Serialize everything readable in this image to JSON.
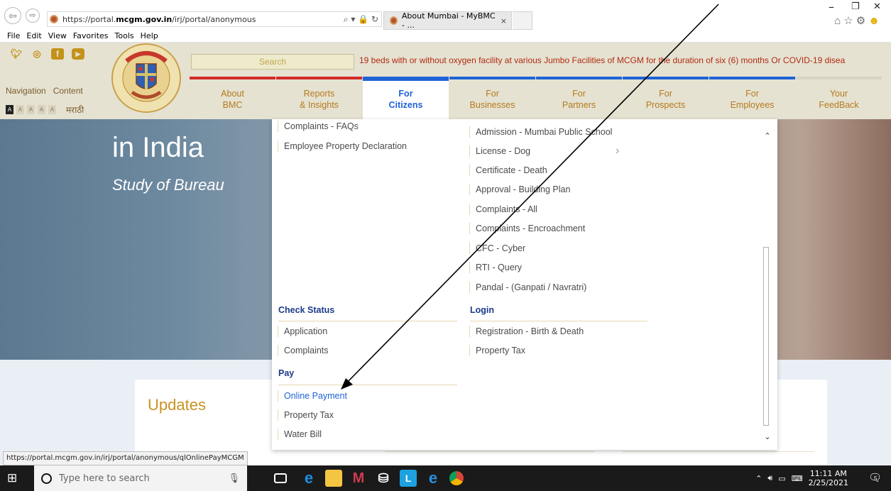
{
  "browser": {
    "back_icon": "back-arrow-icon",
    "forward_icon": "forward-arrow-icon",
    "url_prefix": "https://portal.",
    "url_domain": "mcgm.gov.in",
    "url_path": "/irj/portal/anonymous",
    "address_actions": "⌕ ▾ 🔒 ↻",
    "tab_title": "About Mumbai - MyBMC - ...",
    "tab_close": "×",
    "window_min": "–",
    "window_restore": "❐",
    "window_close": "✕",
    "menu": [
      "File",
      "Edit",
      "View",
      "Favorites",
      "Tools",
      "Help"
    ],
    "status_url": "https://portal.mcgm.gov.in/irj/portal/anonymous/qlOnlinePayMCGM"
  },
  "header": {
    "social": [
      "twitter-icon",
      "instagram-icon",
      "facebook-icon",
      "youtube-icon"
    ],
    "nav_label": "Navigation",
    "content_label": "Content",
    "font_sizes": [
      "A",
      "A",
      "A",
      "A",
      "A"
    ],
    "marathi": "मराठी",
    "search_placeholder": "Search",
    "ticker": "19 beds with or without oxygen facility at various Jumbo Facilities of MCGM for the duration of six (6) months Or COVID-19 disea",
    "tabs": [
      {
        "line1": "About",
        "line2": "BMC"
      },
      {
        "line1": "Reports",
        "line2": "& Insights"
      },
      {
        "line1": "For",
        "line2": "Citizens"
      },
      {
        "line1": "For",
        "line2": "Businesses"
      },
      {
        "line1": "For",
        "line2": "Partners"
      },
      {
        "line1": "For",
        "line2": "Prospects"
      },
      {
        "line1": "For",
        "line2": "Employees"
      },
      {
        "line1": "Your",
        "line2": "FeedBack"
      }
    ]
  },
  "hero": {
    "title": "in India",
    "subtitle": "Study of Bureau"
  },
  "megamenu": {
    "left_top": [
      "Complaints - FAQs",
      "Employee Property Declaration"
    ],
    "right_top": [
      "Admission - Mumbai Public School",
      "License - Dog",
      "Certificate - Death",
      "Approval - Building Plan",
      "Complaints - All",
      "Complaints - Encroachment",
      "CFC - Cyber",
      "RTI - Query",
      "Pandal - (Ganpati / Navratri)"
    ],
    "check_status_head": "Check Status",
    "check_status_items": [
      "Application",
      "Complaints"
    ],
    "login_head": "Login",
    "login_items": [
      "Registration - Birth & Death",
      "Property Tax"
    ],
    "pay_head": "Pay",
    "pay_items": [
      "Online Payment",
      "Property Tax",
      "Water Bill"
    ],
    "chevron": "›",
    "scroll_up": "⌃",
    "scroll_down": "⌄"
  },
  "updates": {
    "title": "Updates"
  },
  "taskbar": {
    "search_placeholder": "Type here to search",
    "time": "11:11 AM",
    "date": "2/25/2021",
    "notification_count": "5"
  }
}
